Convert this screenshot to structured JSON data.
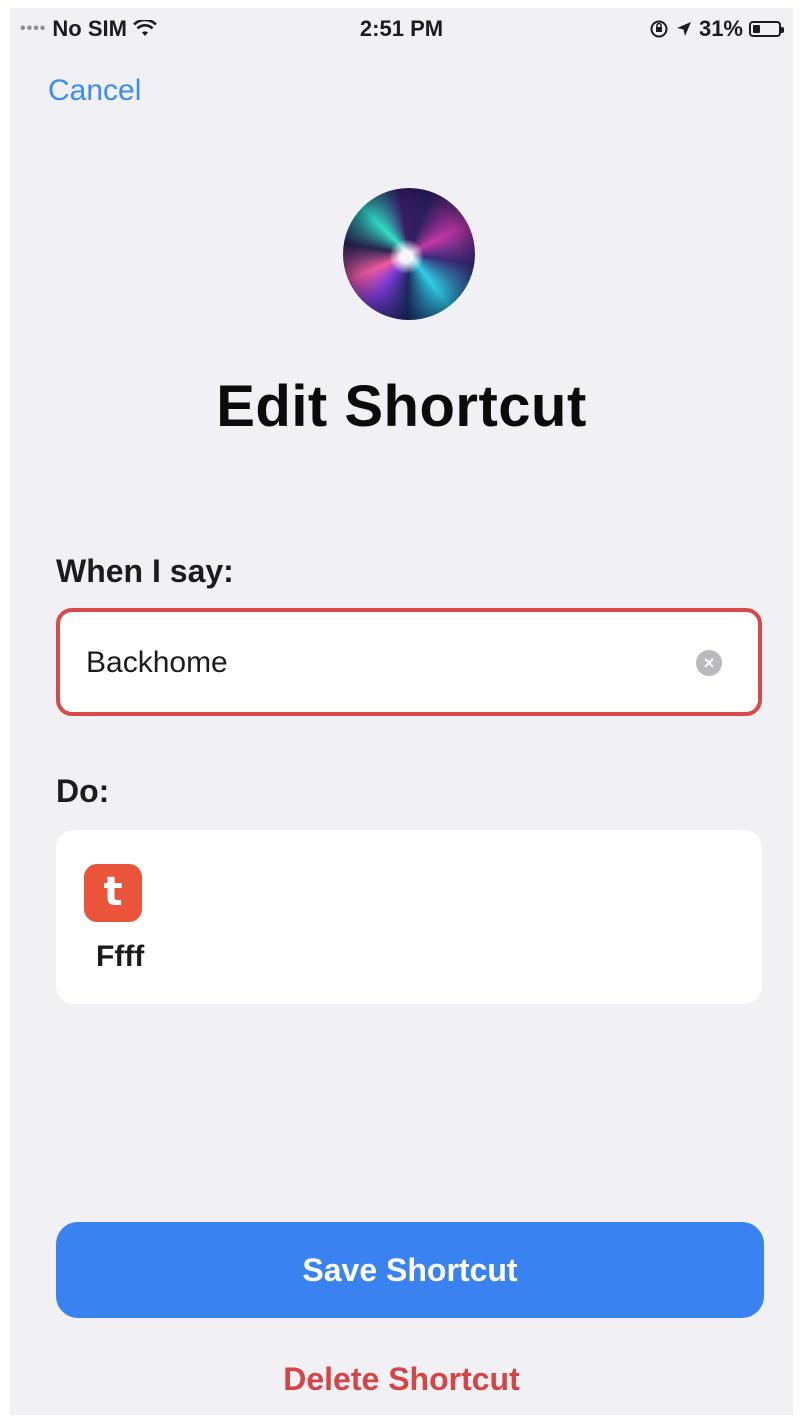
{
  "status_bar": {
    "carrier": "No SIM",
    "time": "2:51 PM",
    "battery": "31%",
    "battery_level": 0.31,
    "icons": [
      "signal-dots-icon",
      "wifi-icon",
      "orientation-lock-icon",
      "location-arrow-icon",
      "battery-icon"
    ]
  },
  "nav": {
    "cancel_label": "Cancel"
  },
  "header": {
    "title": "Edit Shortcut",
    "icon": "siri-orb-icon"
  },
  "phrase": {
    "label": "When I say:",
    "value": "Backhome",
    "clear_icon": "clear-circle-icon",
    "border_color": "#d8494a"
  },
  "action": {
    "label": "Do:",
    "app_icon_letter": "t",
    "app_icon_color": "#e9543a",
    "name": "Ffff"
  },
  "buttons": {
    "save_label": "Save Shortcut",
    "save_color": "#3a82f0",
    "delete_label": "Delete Shortcut",
    "delete_color": "#d64545"
  }
}
